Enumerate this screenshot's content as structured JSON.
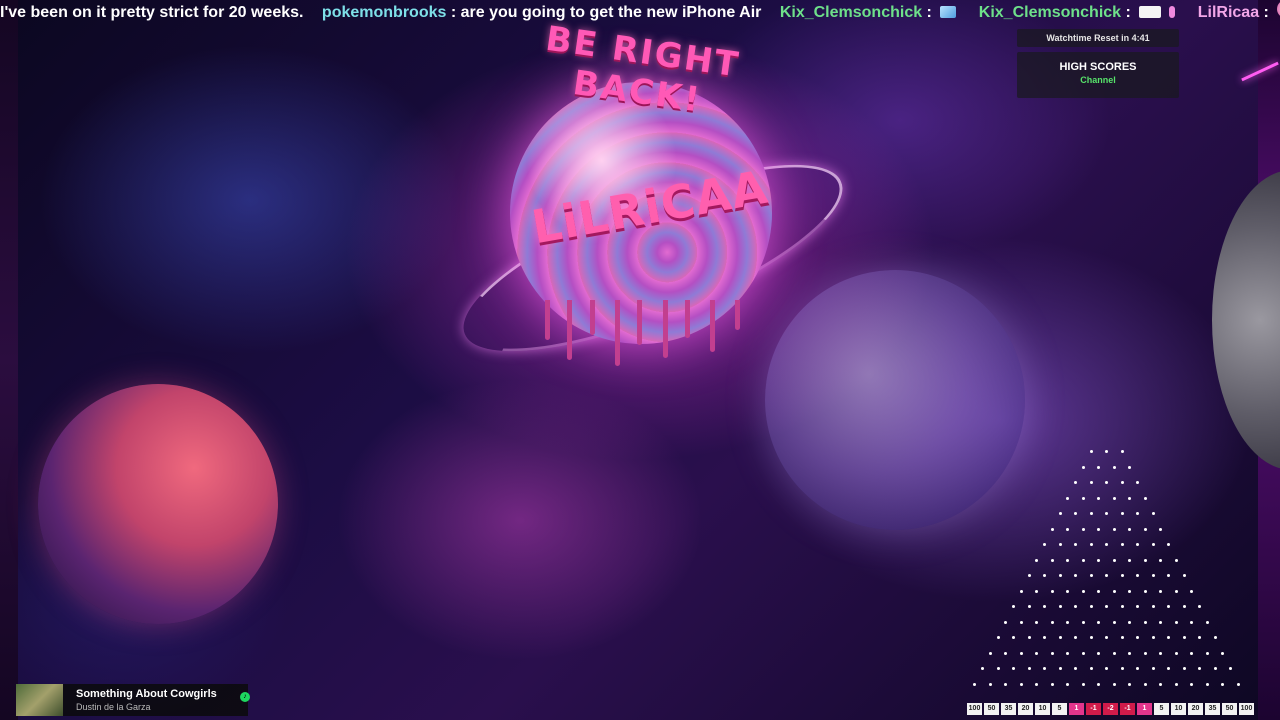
{
  "chat_ticker": {
    "messages": [
      {
        "user": "",
        "text": "I've been on it pretty strict for 20 weeks."
      },
      {
        "user": "pokemonbrooks",
        "text": " : are you going to get the new iPhone Air"
      },
      {
        "user": "Kix_Clemsonchick",
        "text": " : "
      },
      {
        "user": "Kix_Clemsonchick",
        "text": " : "
      },
      {
        "user": "LilRicaa",
        "text": " : "
      }
    ]
  },
  "overlay": {
    "brb_text": "BE RIGHT BACK!",
    "brand_text": "LiLRiCAA",
    "watchtime": "Watchtime Reset in 4:41",
    "high_scores_title": "HIGH SCORES",
    "high_scores_sub": "Channel"
  },
  "plinko": {
    "slots": [
      "100",
      "50",
      "35",
      "20",
      "10",
      "5",
      "1",
      "-1",
      "-2",
      "-1",
      "1",
      "5",
      "10",
      "20",
      "35",
      "50",
      "100"
    ]
  },
  "now_playing": {
    "title": "Something About Cowgirls",
    "artist": "Dustin de la Garza"
  },
  "colors": {
    "accent_pink": "#ff5fae",
    "ticker_user": "#7ee0e8",
    "score_green": "#57e36a"
  }
}
